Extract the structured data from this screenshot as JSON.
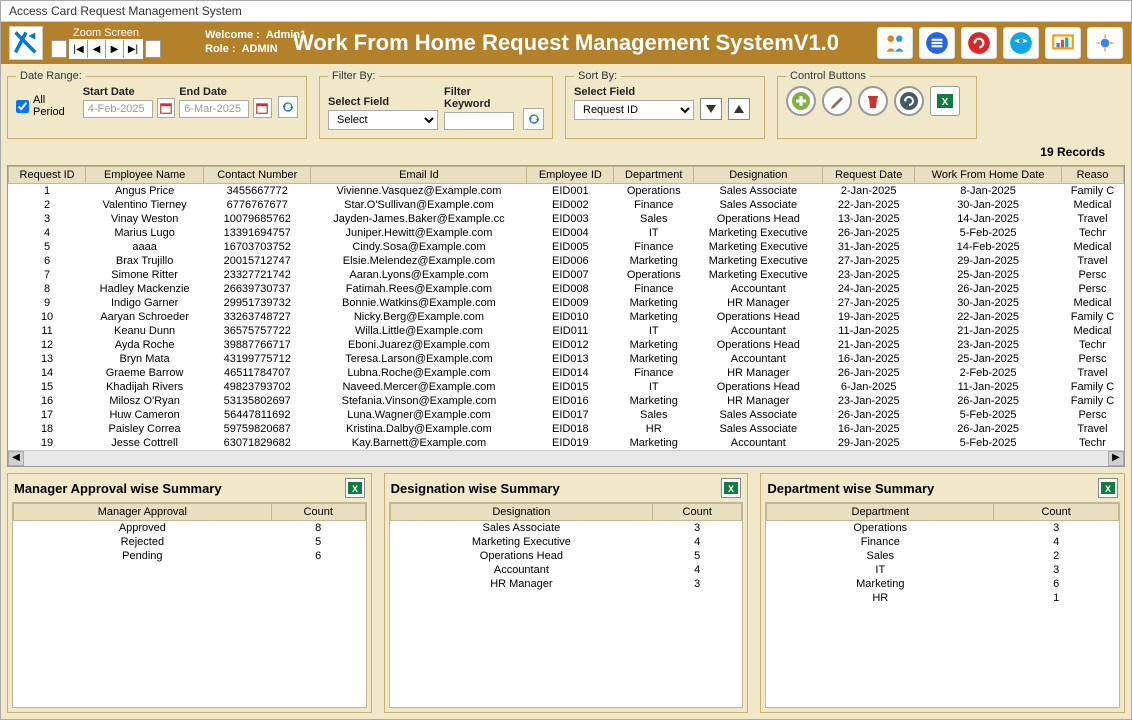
{
  "window_title": "Access Card Request Management System",
  "zoom_label": "Zoom Screen",
  "welcome_label": "Welcome :",
  "welcome_user": "Admin1",
  "role_label": "Role :",
  "role_value": "ADMIN",
  "app_title": "Work From Home Request Management SystemV1.0",
  "date_range": {
    "legend": "Date Range:",
    "all_period": "All Period",
    "start_label": "Start Date",
    "end_label": "End Date",
    "start_value": "4-Feb-2025",
    "end_value": "6-Mar-2025"
  },
  "filter": {
    "legend": "Filter By:",
    "field_label": "Select Field",
    "keyword_label": "Filter Keyword",
    "select_value": "Select"
  },
  "sort": {
    "legend": "Sort By:",
    "field_label": "Select Field",
    "select_value": "Request ID"
  },
  "ctrl_legend": "Control Buttons",
  "records_label": "19 Records",
  "columns": [
    "Request ID",
    "Employee Name",
    "Contact Number",
    "Email Id",
    "Employee ID",
    "Department",
    "Designation",
    "Request Date",
    "Work From Home Date",
    "Reaso"
  ],
  "rows": [
    [
      "1",
      "Angus Price",
      "3455667772",
      "Vivienne.Vasquez@Example.com",
      "EID001",
      "Operations",
      "Sales Associate",
      "2-Jan-2025",
      "8-Jan-2025",
      "Family C"
    ],
    [
      "2",
      "Valentino Tierney",
      "6776767677",
      "Star.O'Sullivan@Example.com",
      "EID002",
      "Finance",
      "Sales Associate",
      "22-Jan-2025",
      "30-Jan-2025",
      "Medical"
    ],
    [
      "3",
      "Vinay Weston",
      "10079685762",
      "Jayden-James.Baker@Example.cc",
      "EID003",
      "Sales",
      "Operations Head",
      "13-Jan-2025",
      "14-Jan-2025",
      "Travel"
    ],
    [
      "4",
      "Marius Lugo",
      "13391694757",
      "Juniper.Hewitt@Example.com",
      "EID004",
      "IT",
      "Marketing Executive",
      "26-Jan-2025",
      "5-Feb-2025",
      "Techr"
    ],
    [
      "5",
      "aaaa",
      "16703703752",
      "Cindy.Sosa@Example.com",
      "EID005",
      "Finance",
      "Marketing Executive",
      "31-Jan-2025",
      "14-Feb-2025",
      "Medical"
    ],
    [
      "6",
      "Brax Trujillo",
      "20015712747",
      "Elsie.Melendez@Example.com",
      "EID006",
      "Marketing",
      "Marketing Executive",
      "27-Jan-2025",
      "29-Jan-2025",
      "Travel"
    ],
    [
      "7",
      "Simone Ritter",
      "23327721742",
      "Aaran.Lyons@Example.com",
      "EID007",
      "Operations",
      "Marketing Executive",
      "23-Jan-2025",
      "25-Jan-2025",
      "Persc"
    ],
    [
      "8",
      "Hadley Mackenzie",
      "26639730737",
      "Fatimah.Rees@Example.com",
      "EID008",
      "Finance",
      "Accountant",
      "24-Jan-2025",
      "26-Jan-2025",
      "Persc"
    ],
    [
      "9",
      "Indigo Garner",
      "29951739732",
      "Bonnie.Watkins@Example.com",
      "EID009",
      "Marketing",
      "HR Manager",
      "27-Jan-2025",
      "30-Jan-2025",
      "Medical"
    ],
    [
      "10",
      "Aaryan Schroeder",
      "33263748727",
      "Nicky.Berg@Example.com",
      "EID010",
      "Marketing",
      "Operations Head",
      "19-Jan-2025",
      "22-Jan-2025",
      "Family C"
    ],
    [
      "11",
      "Keanu Dunn",
      "36575757722",
      "Willa.Little@Example.com",
      "EID011",
      "IT",
      "Accountant",
      "11-Jan-2025",
      "21-Jan-2025",
      "Medical"
    ],
    [
      "12",
      "Ayda Roche",
      "39887766717",
      "Eboni.Juarez@Example.com",
      "EID012",
      "Marketing",
      "Operations Head",
      "21-Jan-2025",
      "23-Jan-2025",
      "Techr"
    ],
    [
      "13",
      "Bryn Mata",
      "43199775712",
      "Teresa.Larson@Example.com",
      "EID013",
      "Marketing",
      "Accountant",
      "16-Jan-2025",
      "25-Jan-2025",
      "Persc"
    ],
    [
      "14",
      "Graeme Barrow",
      "46511784707",
      "Lubna.Roche@Example.com",
      "EID014",
      "Finance",
      "HR Manager",
      "26-Jan-2025",
      "2-Feb-2025",
      "Travel"
    ],
    [
      "15",
      "Khadijah Rivers",
      "49823793702",
      "Naveed.Mercer@Example.com",
      "EID015",
      "IT",
      "Operations Head",
      "6-Jan-2025",
      "11-Jan-2025",
      "Family C"
    ],
    [
      "16",
      "Milosz O'Ryan",
      "53135802697",
      "Stefania.Vinson@Example.com",
      "EID016",
      "Marketing",
      "HR Manager",
      "23-Jan-2025",
      "26-Jan-2025",
      "Family C"
    ],
    [
      "17",
      "Huw Cameron",
      "56447811692",
      "Luna.Wagner@Example.com",
      "EID017",
      "Sales",
      "Sales Associate",
      "26-Jan-2025",
      "5-Feb-2025",
      "Persc"
    ],
    [
      "18",
      "Paisley Correa",
      "59759820687",
      "Kristina.Dalby@Example.com",
      "EID018",
      "HR",
      "Sales Associate",
      "16-Jan-2025",
      "26-Jan-2025",
      "Travel"
    ],
    [
      "19",
      "Jesse Cottrell",
      "63071829682",
      "Kay.Barnett@Example.com",
      "EID019",
      "Marketing",
      "Accountant",
      "29-Jan-2025",
      "5-Feb-2025",
      "Techr"
    ]
  ],
  "summary1": {
    "title": "Manager Approval wise Summary",
    "cols": [
      "Manager Approval",
      "Count"
    ],
    "rows": [
      [
        "Approved",
        "8"
      ],
      [
        "Rejected",
        "5"
      ],
      [
        "Pending",
        "6"
      ]
    ]
  },
  "summary2": {
    "title": "Designation wise Summary",
    "cols": [
      "Designation",
      "Count"
    ],
    "rows": [
      [
        "Sales Associate",
        "3"
      ],
      [
        "Marketing Executive",
        "4"
      ],
      [
        "Operations Head",
        "5"
      ],
      [
        "Accountant",
        "4"
      ],
      [
        "HR Manager",
        "3"
      ]
    ]
  },
  "summary3": {
    "title": "Department wise Summary",
    "cols": [
      "Department",
      "Count"
    ],
    "rows": [
      [
        "Operations",
        "3"
      ],
      [
        "Finance",
        "4"
      ],
      [
        "Sales",
        "2"
      ],
      [
        "IT",
        "3"
      ],
      [
        "Marketing",
        "6"
      ],
      [
        "HR",
        "1"
      ]
    ]
  }
}
